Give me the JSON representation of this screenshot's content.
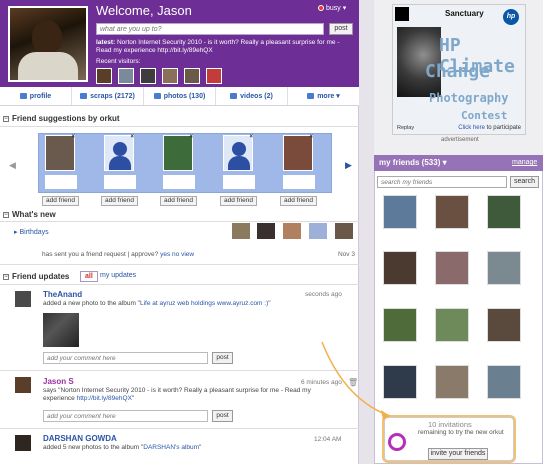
{
  "colors": {
    "brand_purple": "#6d2f95",
    "link_blue": "#2a55a5",
    "callout_orange": "#f3b04a",
    "status_red": "#e33333"
  },
  "profile": {
    "welcome": "Welcome, Jason",
    "status": "busy",
    "status_placeholder": "what are you up to?",
    "post_label": "post",
    "latest_prefix": "latest:",
    "latest_text": "Norton Internet Security 2010 - is it worth? Really a pleasant surprise for me - Read my experience http://bit.ly/89ehQX",
    "recent_visitors_label": "Recent visitors:"
  },
  "nav": [
    {
      "label": "profile",
      "icon": "profile-icon"
    },
    {
      "label": "scraps (2172)",
      "icon": "scraps-icon"
    },
    {
      "label": "photos (130)",
      "icon": "photos-icon"
    },
    {
      "label": "videos (2)",
      "icon": "videos-icon"
    },
    {
      "label": "more ▾",
      "icon": "plus-icon"
    }
  ],
  "suggestions": {
    "title": "Friend suggestions by orkut",
    "add_label": "add friend"
  },
  "whats_new": {
    "title": "What's new",
    "birthdays": "Birthdays",
    "request_text": "has sent you a friend request",
    "approve_label": "approve?",
    "yes": "yes",
    "no": "no",
    "view": "view",
    "date": "Nov 3"
  },
  "updates": {
    "title": "Friend updates",
    "tab_all": "all",
    "tab_mine": "my updates",
    "comment_placeholder": "add your comment here",
    "post_label": "post",
    "items": [
      {
        "name": "TheAnand",
        "text_prefix": "added a new photo to the album \"",
        "album": "Life at ayruz web holdings www.ayruz.com :)",
        "text_suffix": "\"",
        "time": "seconds ago"
      },
      {
        "name": "Jason S",
        "text": "says \"Norton Internet Security 2010 - is it worth? Really a pleasant surprise for me - Read my experience",
        "link": "http://bit.ly/89ehQX",
        "link_suffix": "\"",
        "time": "6 minutes ago"
      },
      {
        "name": "DARSHAN GOWDA",
        "text_prefix": "added 5 new photos to the album \"",
        "album": "DARSHAN's album",
        "text_suffix": "\"",
        "time": "12:04 AM"
      }
    ]
  },
  "ad": {
    "sanctuary": "Sanctuary",
    "hp": "hp",
    "line1": "HP Climate",
    "line2": "Change",
    "line3": "Photography",
    "line4": "Contest",
    "replay": "Replay",
    "cta_link": "Click here",
    "cta_suffix": "to participate",
    "label": "advertisement"
  },
  "friends": {
    "title": "my friends (533)",
    "manage": "manage",
    "search_placeholder": "search my friends",
    "search_label": "search"
  },
  "invite": {
    "count": "10 invitations",
    "text": "remaining to try the new orkut",
    "button": "invite your friends"
  }
}
